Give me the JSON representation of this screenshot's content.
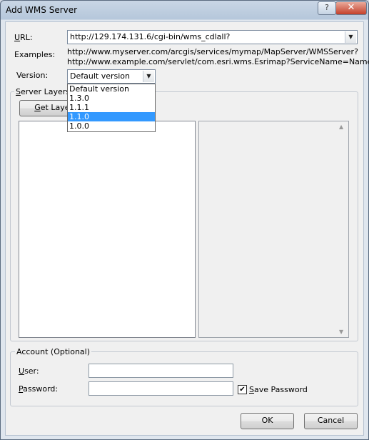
{
  "window": {
    "title": "Add WMS Server"
  },
  "titlebar": {
    "help_glyph": "?",
    "close_glyph": "✕"
  },
  "url": {
    "label_accel": "U",
    "label_rest": "RL:",
    "value": "http://129.174.131.6/cgi-bin/wms_cdlall?"
  },
  "examples": {
    "label": "Examples:",
    "line1": "http://www.myserver.com/arcgis/services/mymap/MapServer/WMSServer?",
    "line2": "http://www.example.com/servlet/com.esri.wms.Esrimap?ServiceName=Name&"
  },
  "version": {
    "label": "Version:",
    "value": "Default version",
    "options": [
      "Default version",
      "1.3.0",
      "1.1.1",
      "1.1.0",
      "1.0.0"
    ],
    "highlighted": "1.1.0"
  },
  "server_layers": {
    "label_accel": "S",
    "label_rest": "erver Layers",
    "get_layers_accel": "G",
    "get_layers_rest": "et Layers"
  },
  "account": {
    "label": "Account (Optional)",
    "user_label_accel": "U",
    "user_label_rest": "ser:",
    "user_value": "",
    "password_label_accel": "P",
    "password_label_rest": "assword:",
    "password_value": "",
    "save_password_accel": "S",
    "save_password_rest": "ave Password",
    "save_password_checked": true
  },
  "buttons": {
    "ok": "OK",
    "cancel": "Cancel"
  }
}
